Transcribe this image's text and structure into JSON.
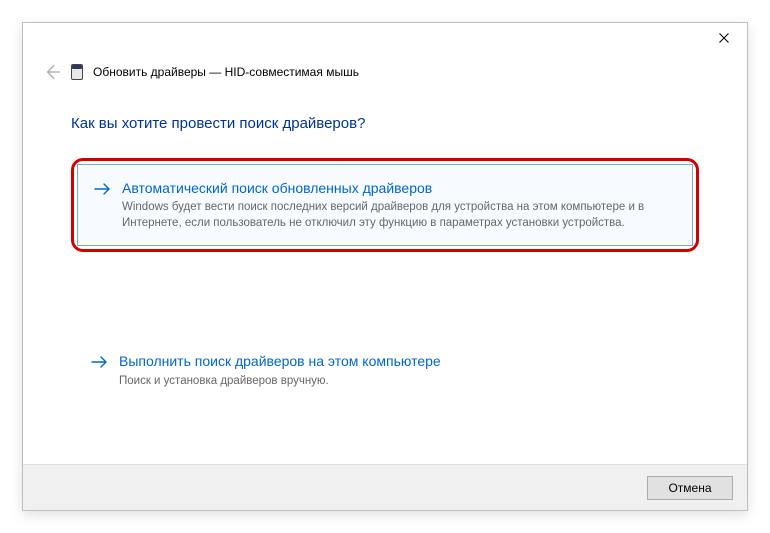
{
  "title": "Обновить драйверы — HID-совместимая мышь",
  "heading": "Как вы хотите провести поиск драйверов?",
  "options": {
    "auto": {
      "title": "Автоматический поиск обновленных драйверов",
      "desc": "Windows будет вести поиск последних версий драйверов для устройства на этом компьютере и в Интернете, если пользователь не отключил эту функцию в параметрах установки устройства."
    },
    "manual": {
      "title": "Выполнить поиск драйверов на этом компьютере",
      "desc": "Поиск и установка драйверов вручную."
    }
  },
  "footer": {
    "cancel": "Отмена"
  }
}
